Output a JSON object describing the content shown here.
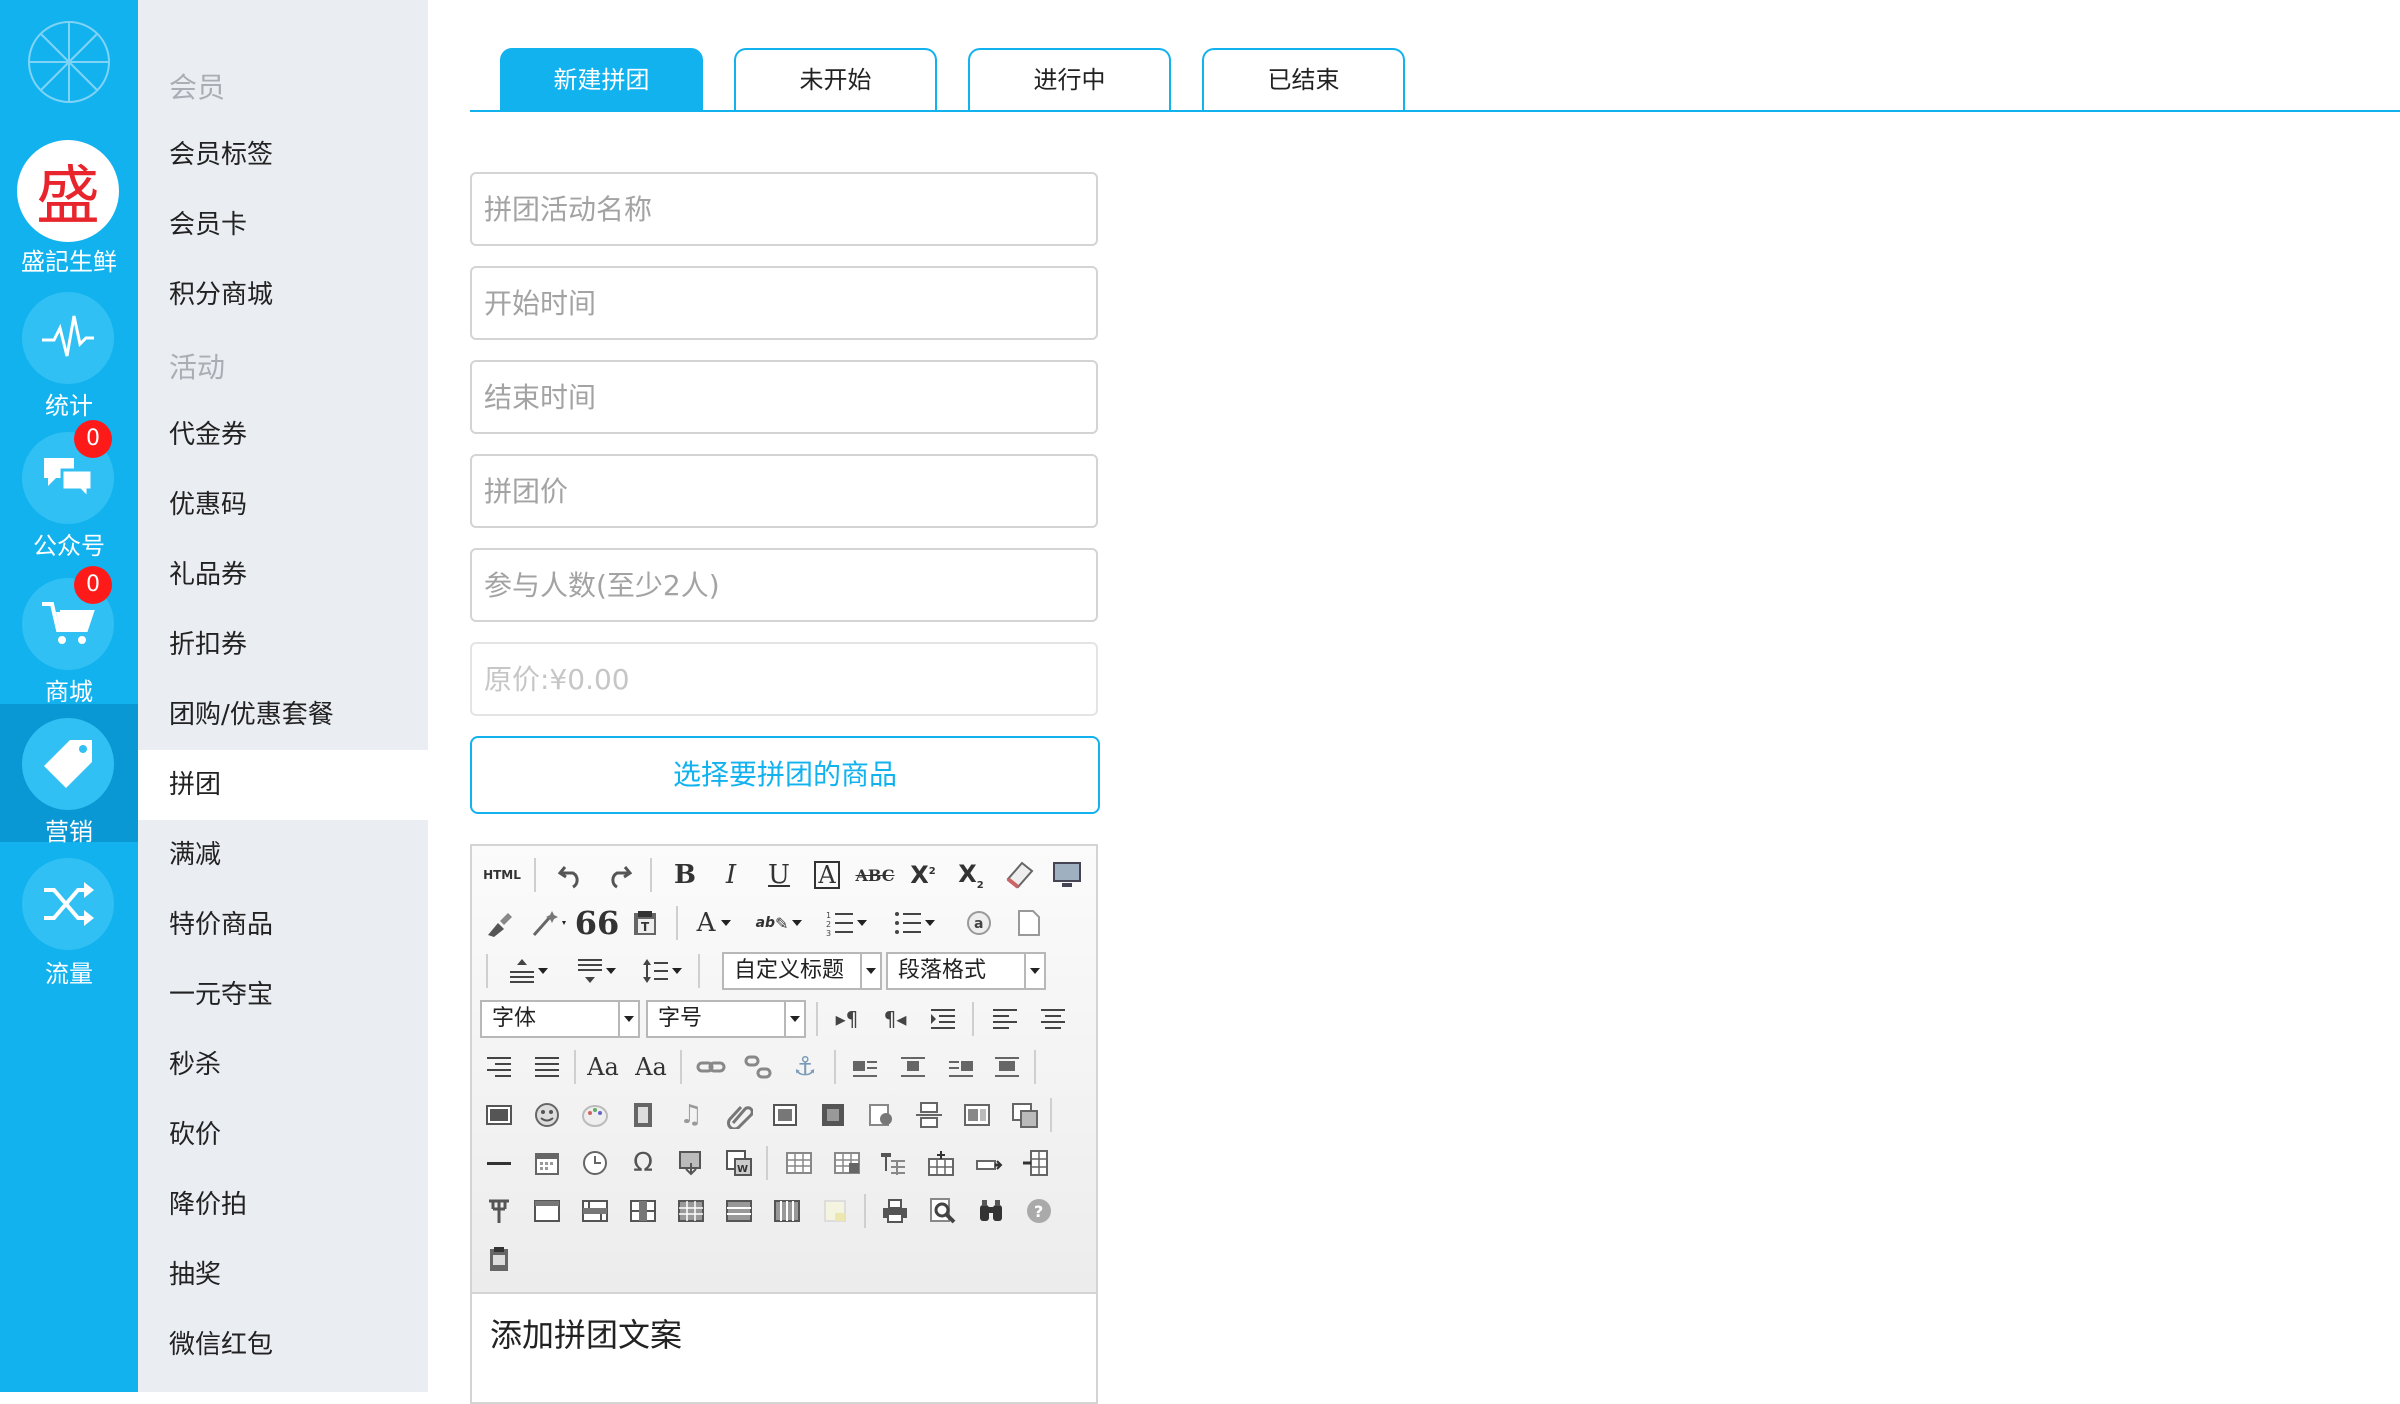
{
  "rail": {
    "store": {
      "name": "盛記生鲜",
      "logo_char": "盛"
    },
    "items": [
      {
        "label": "统计",
        "icon": "pulse-icon"
      },
      {
        "label": "公众号",
        "icon": "chat-bubbles-icon",
        "badge": "0"
      },
      {
        "label": "商城",
        "icon": "shopping-cart-icon",
        "badge": "0"
      },
      {
        "label": "营销",
        "icon": "price-tag-icon",
        "active": true
      },
      {
        "label": "流量",
        "icon": "shuffle-icon"
      }
    ]
  },
  "menu": {
    "groups": [
      "会员",
      "活动"
    ],
    "member_items": [
      "会员标签",
      "会员卡",
      "积分商城"
    ],
    "activity_items": [
      "代金券",
      "优惠码",
      "礼品券",
      "折扣券",
      "团购/优惠套餐",
      "拼团",
      "满减",
      "特价商品",
      "一元夺宝",
      "秒杀",
      "砍价",
      "降价拍",
      "抽奖",
      "微信红包"
    ],
    "active": "拼团"
  },
  "tabs": [
    "新建拼团",
    "未开始",
    "进行中",
    "已结束"
  ],
  "form": {
    "name_placeholder": "拼团活动名称",
    "start_placeholder": "开始时间",
    "end_placeholder": "结束时间",
    "price_placeholder": "拼团价",
    "people_placeholder": "参与人数(至少2人)",
    "original_price_placeholder": "原价:¥0.00",
    "select_goods_label": "选择要拼团的商品"
  },
  "editor": {
    "html_label": "HTML",
    "custom_title": "自定义标题",
    "paragraph_format": "段落格式",
    "font_family": "字体",
    "font_size": "字号",
    "content": "添加拼团文案"
  },
  "colors": {
    "accent": "#12b2ef",
    "rail_active": "#0a98d4",
    "badge": "#ff1a1a",
    "menu_bg": "#eaedf2"
  }
}
